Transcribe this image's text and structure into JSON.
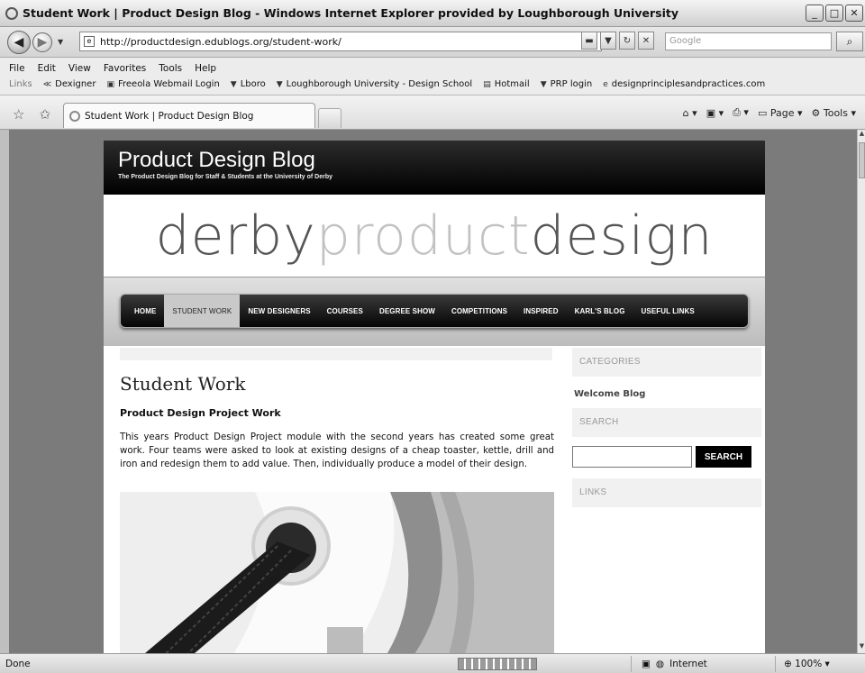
{
  "window": {
    "title": "Student Work | Product Design Blog - Windows Internet Explorer provided by Loughborough University"
  },
  "nav": {
    "url": "http://productdesign.edublogs.org/student-work/",
    "search_placeholder": "Google",
    "refresh_label": "↻",
    "stop_label": "✕"
  },
  "menu": [
    "File",
    "Edit",
    "View",
    "Favorites",
    "Tools",
    "Help"
  ],
  "links_bar": {
    "label": "Links",
    "items": [
      {
        "label": "Dexigner",
        "icon": "dexigner-icon"
      },
      {
        "label": "Freeola Webmail Login",
        "icon": "webmail-icon"
      },
      {
        "label": "Lboro",
        "icon": "lboro-icon"
      },
      {
        "label": "Loughborough University - Design School",
        "icon": "lboro-icon"
      },
      {
        "label": "Hotmail",
        "icon": "hotmail-icon"
      },
      {
        "label": "PRP login",
        "icon": "lboro-icon"
      },
      {
        "label": "designprinciplesandpractices.com",
        "icon": "page-icon"
      }
    ]
  },
  "tabs": [
    {
      "label": "Student Work | Product Design Blog"
    }
  ],
  "command_bar": {
    "page_label": "Page",
    "tools_label": "Tools"
  },
  "site": {
    "title": "Product Design Blog",
    "tagline": "The Product Design Blog for Staff & Students at the University of Derby",
    "banner": {
      "part1": "derby",
      "part2": "product",
      "part3": "design"
    },
    "nav_items": [
      "HOME",
      "STUDENT WORK",
      "NEW DESIGNERS",
      "COURSES",
      "DEGREE SHOW",
      "COMPETITIONS",
      "INSPIRED",
      "KARL'S BLOG",
      "USEFUL LINKS"
    ],
    "active_nav": "STUDENT WORK",
    "post": {
      "title": "Student Work",
      "subtitle": "Product Design Project Work",
      "body": "This years Product Design Project module with the second years has created some great work. Four teams were asked to look at existing designs of a cheap toaster, kettle, drill and iron and redesign them to add value. Then, individually produce a model of their design."
    },
    "sidebar": {
      "categories_heading": "CATEGORIES",
      "category_link": "Welcome Blog",
      "search_heading": "SEARCH",
      "search_button": "SEARCH",
      "links_heading": "LINKS"
    }
  },
  "status": {
    "text": "Done",
    "zone": "Internet",
    "zoom": "100%"
  }
}
